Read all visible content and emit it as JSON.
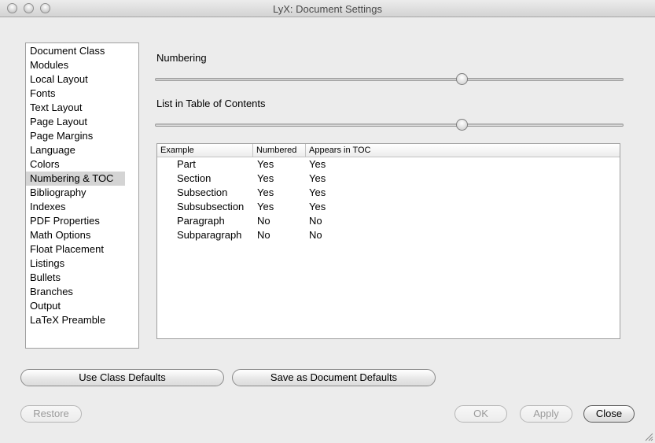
{
  "window": {
    "title": "LyX: Document Settings"
  },
  "sidebar": {
    "items": [
      "Document Class",
      "Modules",
      "Local Layout",
      "Fonts",
      "Text Layout",
      "Page Layout",
      "Page Margins",
      "Language",
      "Colors",
      "Numbering & TOC",
      "Bibliography",
      "Indexes",
      "PDF Properties",
      "Math Options",
      "Float Placement",
      "Listings",
      "Bullets",
      "Branches",
      "Output",
      "LaTeX Preamble"
    ],
    "selected": "Numbering & TOC"
  },
  "numbering": {
    "label": "Numbering",
    "slider_fraction": 0.66
  },
  "toc": {
    "label": "List in Table of Contents",
    "slider_fraction": 0.66
  },
  "table": {
    "headers": [
      "Example",
      "Numbered",
      "Appears in TOC"
    ],
    "rows": [
      [
        "Part",
        "Yes",
        "Yes"
      ],
      [
        "Section",
        "Yes",
        "Yes"
      ],
      [
        "Subsection",
        "Yes",
        "Yes"
      ],
      [
        "Subsubsection",
        "Yes",
        "Yes"
      ],
      [
        "Paragraph",
        "No",
        "No"
      ],
      [
        "Subparagraph",
        "No",
        "No"
      ]
    ]
  },
  "buttons": {
    "use_class_defaults": "Use Class Defaults",
    "save_as_document_defaults": "Save as Document Defaults",
    "restore": "Restore",
    "ok": "OK",
    "apply": "Apply",
    "close": "Close"
  },
  "icons": {
    "close": "close-window-icon",
    "minimize": "minimize-window-icon",
    "zoom": "zoom-window-icon",
    "resize": "resize-grip-icon"
  }
}
